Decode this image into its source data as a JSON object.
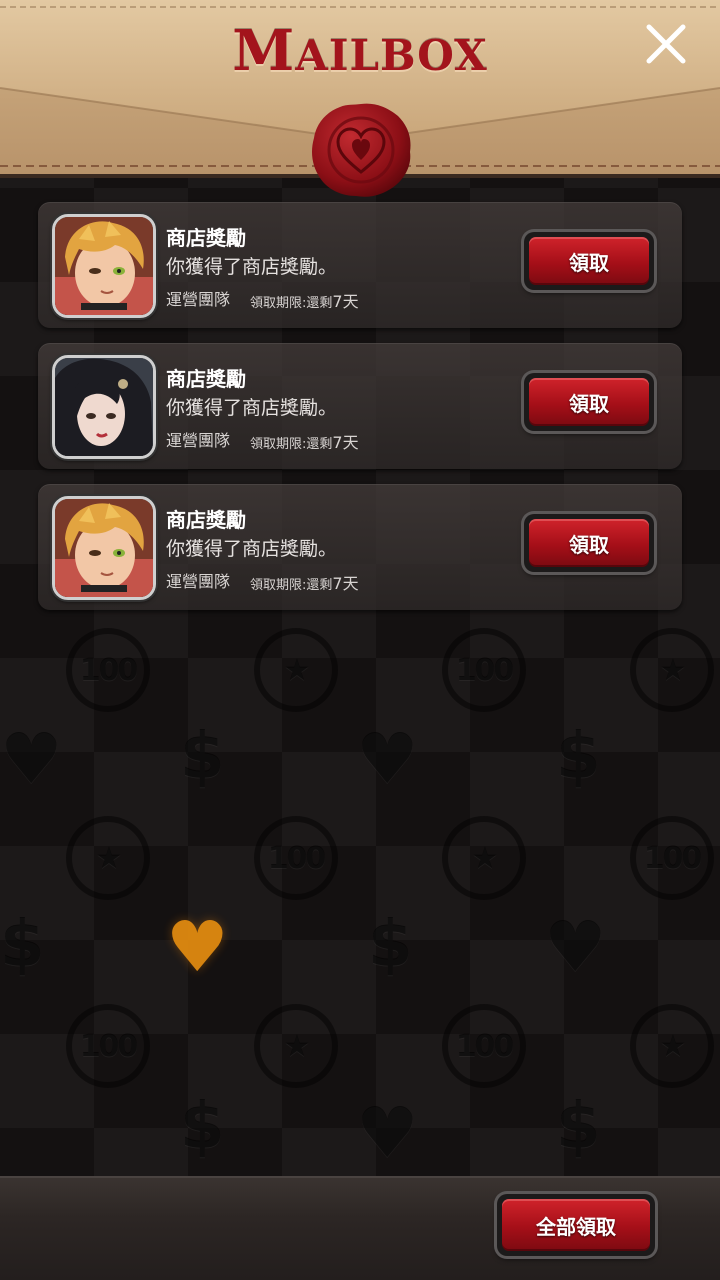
{
  "header": {
    "title_first": "M",
    "title_rest": "AILBOX"
  },
  "mails": [
    {
      "title": "商店獎勵",
      "body": "你獲得了商店獎勵。",
      "sender": "運營團隊",
      "expiry_label": "領取期限:還剩",
      "expiry_days": "7天",
      "claim_label": "領取",
      "avatar": "blonde-character-portrait"
    },
    {
      "title": "商店獎勵",
      "body": "你獲得了商店獎勵。",
      "sender": "運營團隊",
      "expiry_label": "領取期限:還剩",
      "expiry_days": "7天",
      "claim_label": "領取",
      "avatar": "dark-haired-character-portrait"
    },
    {
      "title": "商店獎勵",
      "body": "你獲得了商店獎勵。",
      "sender": "運營團隊",
      "expiry_label": "領取期限:還剩",
      "expiry_days": "7天",
      "claim_label": "領取",
      "avatar": "blonde-character-portrait"
    }
  ],
  "footer": {
    "claim_all_label": "全部領取"
  },
  "background": {
    "coin_text": "100",
    "dollar_symbol": "$",
    "heart_symbol": "♥"
  },
  "colors": {
    "accent_red": "#a50f18",
    "title_red": "#a3141c",
    "envelope": "#d6b891"
  }
}
